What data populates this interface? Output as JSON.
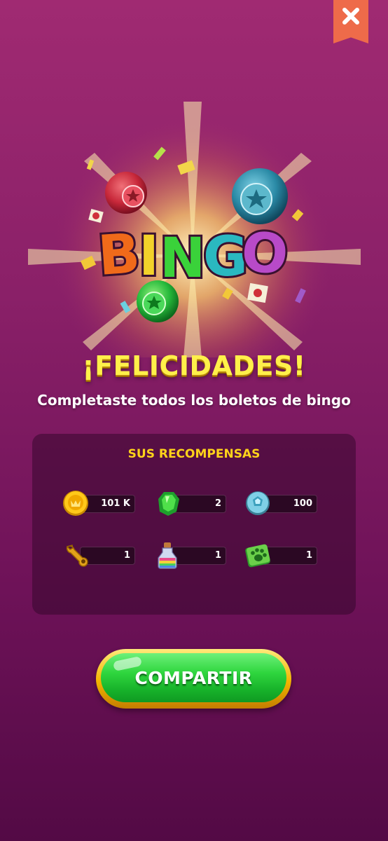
{
  "close": {
    "icon": "close-icon",
    "color": "#ee6b4a"
  },
  "hero": {
    "logo_text": "BINGO"
  },
  "title": "¡FELICIDADES!",
  "subtitle": "Completaste todos los boletos de bingo",
  "rewards": {
    "heading": "SUS RECOMPENSAS",
    "items": [
      {
        "icon": "coin-icon",
        "value": "101 K"
      },
      {
        "icon": "green-gem-icon",
        "value": "2"
      },
      {
        "icon": "blue-token-icon",
        "value": "100"
      },
      {
        "icon": "wrench-icon",
        "value": "1"
      },
      {
        "icon": "rainbow-potion-icon",
        "value": "1"
      },
      {
        "icon": "paw-tile-icon",
        "value": "1"
      }
    ]
  },
  "share": {
    "label": "COMPARTIR",
    "color": "#2fd63e",
    "border_color": "#f3b400"
  },
  "colors": {
    "title": "#fff04a",
    "panel_heading": "#ffd31a",
    "background": "#8a2068"
  }
}
